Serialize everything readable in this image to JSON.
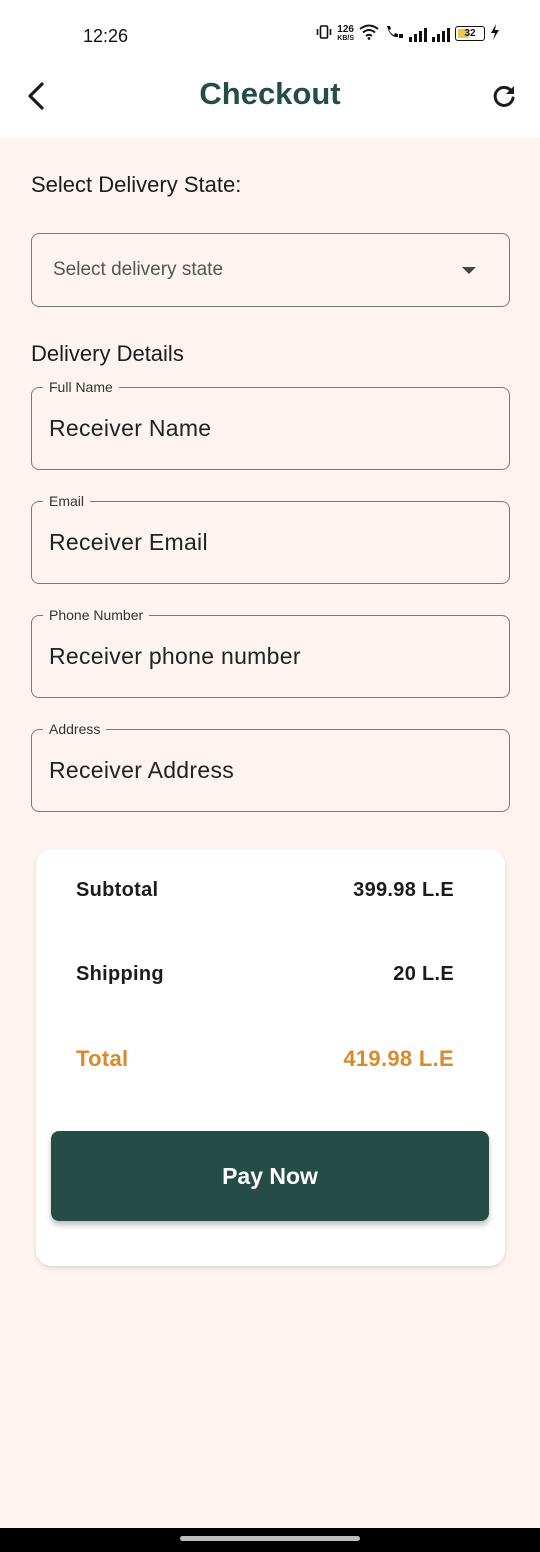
{
  "status_bar": {
    "time": "12:26",
    "net_speed_value": "126",
    "net_speed_unit": "KB/S",
    "battery_level": "32"
  },
  "header": {
    "title": "Checkout",
    "back_icon": "chevron-left-icon",
    "refresh_icon": "refresh-icon"
  },
  "delivery_state": {
    "label": "Select Delivery State:",
    "placeholder": "Select delivery state",
    "dropdown_icon": "caret-down-icon"
  },
  "delivery_details": {
    "heading": "Delivery Details",
    "fields": [
      {
        "label": "Full Name",
        "value": "Receiver Name"
      },
      {
        "label": "Email",
        "value": "Receiver Email"
      },
      {
        "label": "Phone Number",
        "value": "Receiver phone number"
      },
      {
        "label": "Address",
        "value": "Receiver Address"
      }
    ]
  },
  "summary": {
    "subtotal_label": "Subtotal",
    "subtotal_value": "399.98 L.E",
    "shipping_label": "Shipping",
    "shipping_value": "20 L.E",
    "total_label": "Total",
    "total_value": "419.98 L.E",
    "pay_button": "Pay Now"
  },
  "colors": {
    "primary": "#264d45",
    "accent": "#d98a2b",
    "background": "#fdf4f1"
  }
}
